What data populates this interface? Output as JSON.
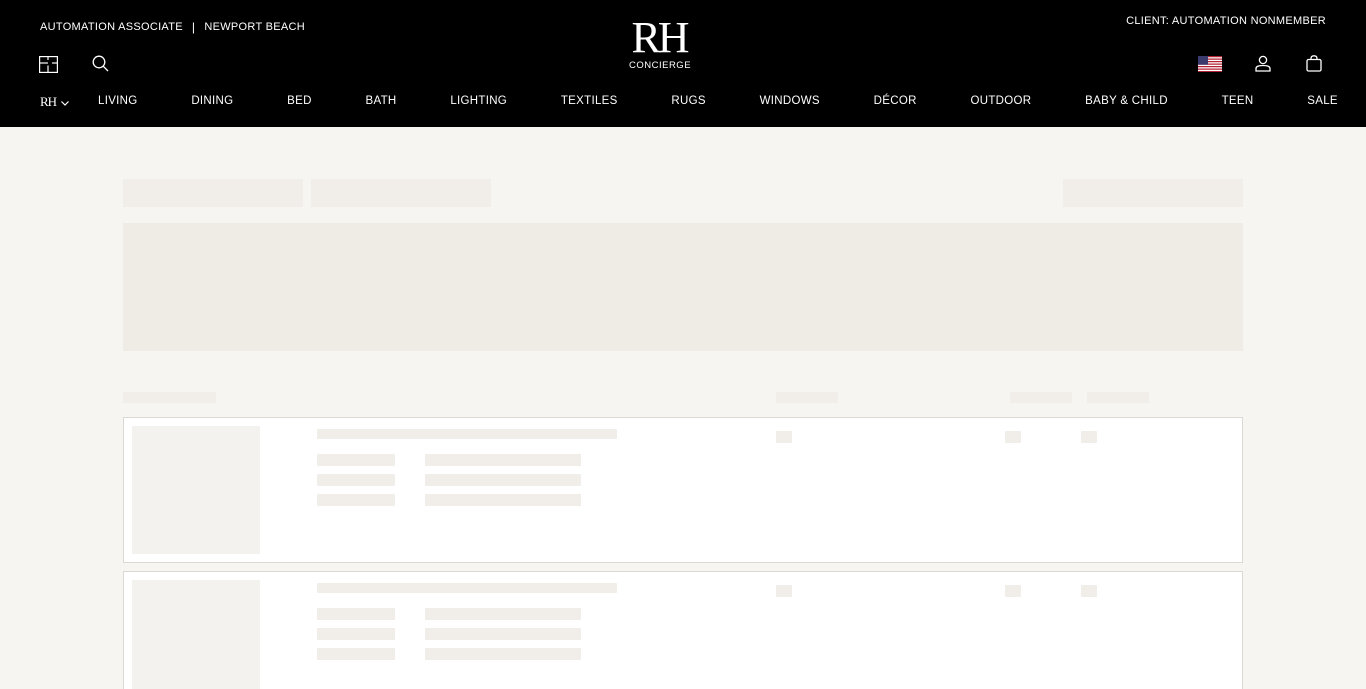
{
  "header": {
    "associate": "AUTOMATION ASSOCIATE",
    "separator": "|",
    "location": "NEWPORT BEACH",
    "client": "CLIENT: AUTOMATION NONMEMBER",
    "logo_mark": "RH",
    "logo_sub": "CONCIERGE",
    "brand_selector": "RH",
    "icons": {
      "floorplan": "floorplan-icon",
      "search": "search-icon",
      "flag": "us-flag-icon",
      "account": "account-icon",
      "cart": "shopping-bag-icon",
      "chevron": "chevron-down-icon"
    }
  },
  "nav": {
    "items": [
      {
        "label": "LIVING"
      },
      {
        "label": "DINING"
      },
      {
        "label": "BED"
      },
      {
        "label": "BATH"
      },
      {
        "label": "LIGHTING"
      },
      {
        "label": "TEXTILES"
      },
      {
        "label": "RUGS"
      },
      {
        "label": "WINDOWS"
      },
      {
        "label": "DÉCOR"
      },
      {
        "label": "OUTDOOR"
      },
      {
        "label": "BABY & CHILD"
      },
      {
        "label": "TEEN"
      },
      {
        "label": "SALE"
      }
    ]
  },
  "colors": {
    "header_bg": "#000000",
    "page_bg": "#f6f5f1",
    "skeleton": "#f1eee9",
    "card_border": "#dcd9d4"
  }
}
